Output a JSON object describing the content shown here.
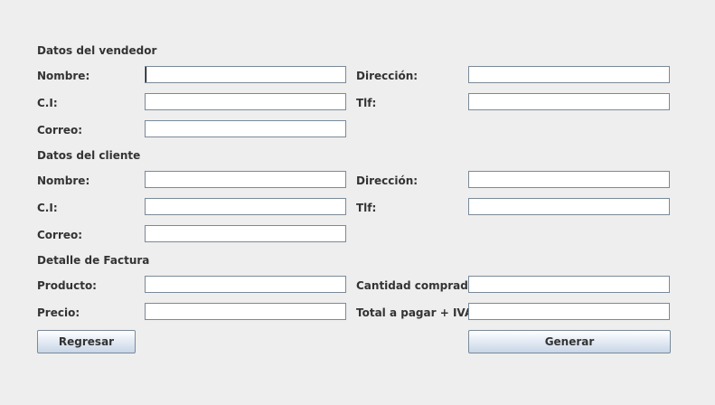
{
  "vendedor": {
    "section_title": "Datos del vendedor",
    "nombre_label": "Nombre:",
    "direccion_label": "Dirección:",
    "ci_label": "C.I:",
    "tlf_label": "Tlf:",
    "correo_label": "Correo:",
    "nombre_value": "",
    "direccion_value": "",
    "ci_value": "",
    "tlf_value": "",
    "correo_value": ""
  },
  "cliente": {
    "section_title": "Datos del cliente",
    "nombre_label": "Nombre:",
    "direccion_label": "Dirección:",
    "ci_label": "C.I:",
    "tlf_label": "Tlf:",
    "correo_label": "Correo:",
    "nombre_value": "",
    "direccion_value": "",
    "ci_value": "",
    "tlf_value": "",
    "correo_value": ""
  },
  "factura": {
    "section_title": "Detalle de Factura",
    "producto_label": "Producto:",
    "cantidad_label": "Cantidad comprada:",
    "precio_label": "Precio:",
    "total_label": "Total a pagar + IVA:",
    "producto_value": "",
    "cantidad_value": "",
    "precio_value": "",
    "total_value": ""
  },
  "buttons": {
    "regresar_label": "Regresar",
    "generar_label": "Generar"
  }
}
